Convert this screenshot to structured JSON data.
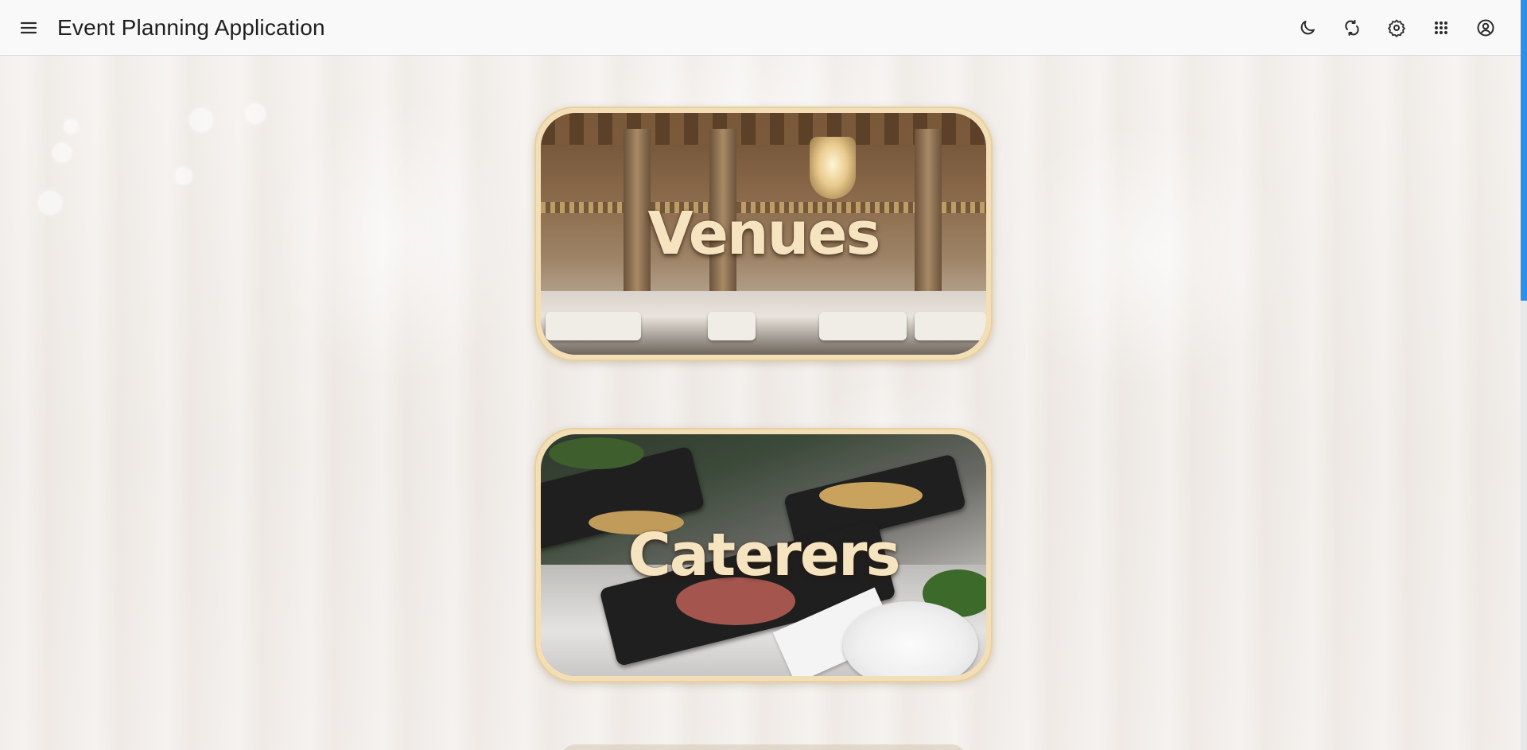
{
  "app": {
    "title": "Event Planning Application"
  },
  "toolbar": {
    "icons": [
      "menu-icon",
      "dark-mode-icon",
      "sync-icon",
      "settings-icon",
      "apps-grid-icon",
      "account-icon"
    ]
  },
  "categories": [
    {
      "label": "Venues"
    },
    {
      "label": "Caterers"
    }
  ],
  "colors": {
    "appbar_bg": "#f9f9f9",
    "card_frame": "#f3dfb7",
    "card_text": "#f6e4c0",
    "scroll_thumb": "#2f8fe8",
    "page_bg": "#f3efeb"
  }
}
